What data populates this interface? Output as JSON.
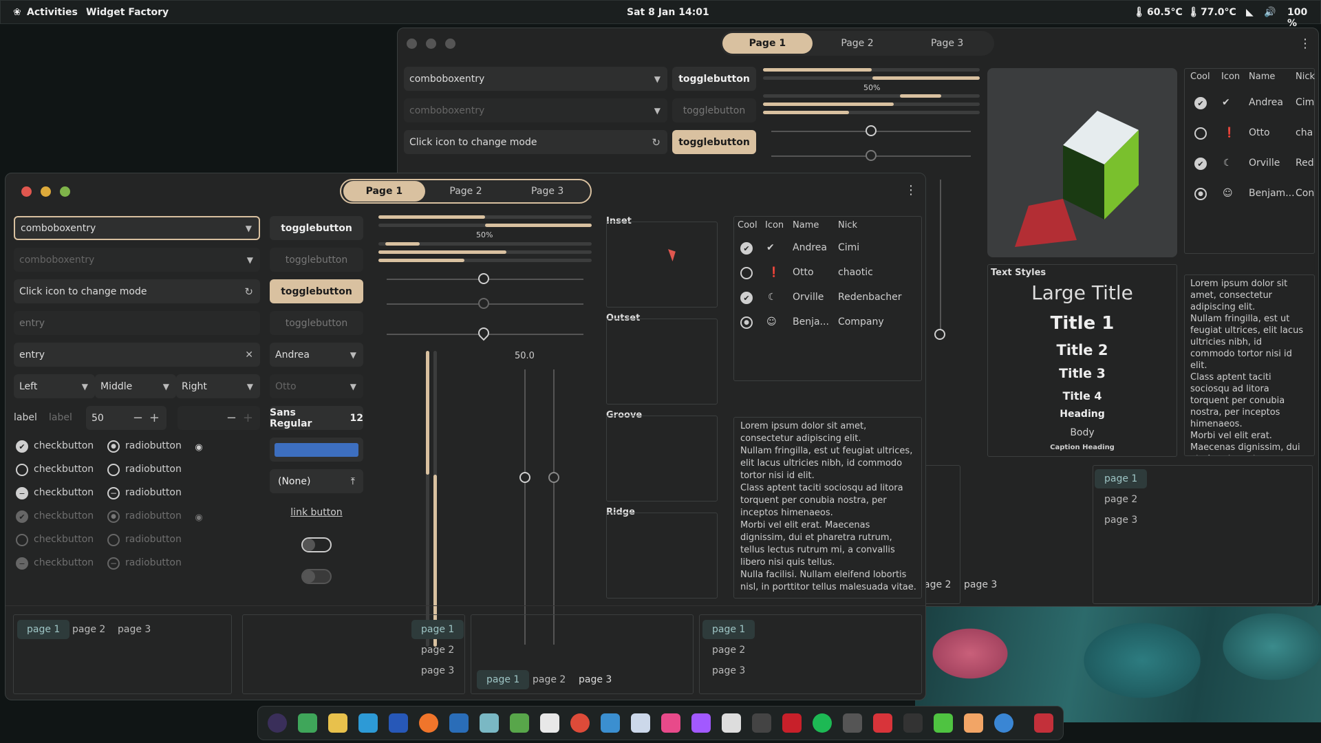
{
  "topbar": {
    "activities": "Activities",
    "app": "Widget Factory",
    "clock": "Sat 8 Jan  14:01",
    "temp1": "60.5°C",
    "temp2": "77.0°C",
    "battery": "100 %"
  },
  "tabs": [
    "Page 1",
    "Page 2",
    "Page 3"
  ],
  "front": {
    "combo1": "comboboxentry",
    "combo2": "comboboxentry",
    "mode": "Click icon to change mode",
    "entry1": "entry",
    "entry2": "entry",
    "seg": [
      "Left",
      "Middle",
      "Right"
    ],
    "label1": "label",
    "label2": "label",
    "spin": "50",
    "toggle": "togglebutton",
    "combo_andrea": "Andrea",
    "combo_otto": "Otto",
    "font": "Sans Regular",
    "font_size": "12",
    "file": "(None)",
    "link": "link button",
    "checkbutton": "checkbutton",
    "radiobutton": "radiobutton",
    "progress_label": "50%",
    "scale_value": "50.0",
    "frames": [
      "Inset",
      "Outset",
      "Groove",
      "Ridge"
    ],
    "pages": [
      "page 1",
      "page 2",
      "page 3"
    ],
    "text": "Lorem ipsum dolor sit amet, consectetur adipiscing elit.\nNullam fringilla, est ut feugiat ultrices, elit lacus ultricies nibh, id commodo tortor nisi id elit.\nClass aptent taciti sociosqu ad litora torquent per conubia nostra, per inceptos himenaeos.\nMorbi vel elit erat. Maecenas dignissim, dui et pharetra rutrum, tellus lectus rutrum mi, a convallis libero nisi quis tellus.\nNulla facilisi. Nullam eleifend lobortis nisl, in porttitor tellus malesuada vitae."
  },
  "tree": {
    "columns": [
      "Cool",
      "Icon",
      "Name",
      "Nick"
    ],
    "rows": [
      {
        "name": "Andrea",
        "nick": "Cimi",
        "icon": "check-circle-icon"
      },
      {
        "name": "Otto",
        "nick": "chaotic",
        "icon": "exclamation-icon"
      },
      {
        "name": "Orville",
        "nick": "Redenbacher",
        "icon": "moon-icon"
      },
      {
        "name": "Benja...",
        "nick": "Company",
        "icon": "face-icon"
      }
    ]
  },
  "back": {
    "combo1": "comboboxentry",
    "combo2": "comboboxentry",
    "mode": "Click icon to change mode",
    "toggle": "togglebutton",
    "tree_names": [
      "Andrea",
      "Otto",
      "Orville",
      "Benjam..."
    ],
    "tree_nicks": [
      "Cim",
      "cha",
      "Red",
      "Con"
    ],
    "text_styles_label": "Text Styles",
    "styles": [
      "Large Title",
      "Title 1",
      "Title 2",
      "Title 3",
      "Title 4",
      "Heading",
      "Body",
      "Caption Heading"
    ],
    "text": "Lorem ipsum dolor sit amet, consectetur adipiscing elit.\nNullam fringilla, est ut feugiat ultrices, elit lacus ultricies nibh, id commodo tortor nisi id elit.\nClass aptent taciti sociosqu ad litora torquent per conubia nostra, per inceptos himenaeos.\nMorbi vel elit erat. Maecenas dignissim, dui et pharetra rutrum,",
    "pages_bottom": [
      "age 2",
      "page 3"
    ]
  },
  "colors": {
    "accent": "#d9c1a0",
    "bg": "#232424"
  }
}
